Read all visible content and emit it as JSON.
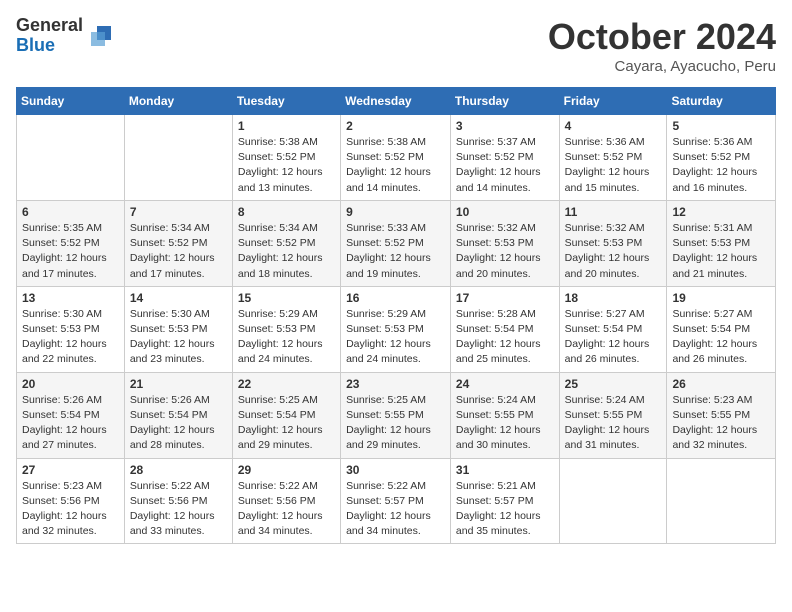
{
  "logo": {
    "general": "General",
    "blue": "Blue"
  },
  "title": "October 2024",
  "subtitle": "Cayara, Ayacucho, Peru",
  "weekdays": [
    "Sunday",
    "Monday",
    "Tuesday",
    "Wednesday",
    "Thursday",
    "Friday",
    "Saturday"
  ],
  "weeks": [
    [
      {
        "day": "",
        "info": ""
      },
      {
        "day": "",
        "info": ""
      },
      {
        "day": "1",
        "info": "Sunrise: 5:38 AM\nSunset: 5:52 PM\nDaylight: 12 hours and 13 minutes."
      },
      {
        "day": "2",
        "info": "Sunrise: 5:38 AM\nSunset: 5:52 PM\nDaylight: 12 hours and 14 minutes."
      },
      {
        "day": "3",
        "info": "Sunrise: 5:37 AM\nSunset: 5:52 PM\nDaylight: 12 hours and 14 minutes."
      },
      {
        "day": "4",
        "info": "Sunrise: 5:36 AM\nSunset: 5:52 PM\nDaylight: 12 hours and 15 minutes."
      },
      {
        "day": "5",
        "info": "Sunrise: 5:36 AM\nSunset: 5:52 PM\nDaylight: 12 hours and 16 minutes."
      }
    ],
    [
      {
        "day": "6",
        "info": "Sunrise: 5:35 AM\nSunset: 5:52 PM\nDaylight: 12 hours and 17 minutes."
      },
      {
        "day": "7",
        "info": "Sunrise: 5:34 AM\nSunset: 5:52 PM\nDaylight: 12 hours and 17 minutes."
      },
      {
        "day": "8",
        "info": "Sunrise: 5:34 AM\nSunset: 5:52 PM\nDaylight: 12 hours and 18 minutes."
      },
      {
        "day": "9",
        "info": "Sunrise: 5:33 AM\nSunset: 5:52 PM\nDaylight: 12 hours and 19 minutes."
      },
      {
        "day": "10",
        "info": "Sunrise: 5:32 AM\nSunset: 5:53 PM\nDaylight: 12 hours and 20 minutes."
      },
      {
        "day": "11",
        "info": "Sunrise: 5:32 AM\nSunset: 5:53 PM\nDaylight: 12 hours and 20 minutes."
      },
      {
        "day": "12",
        "info": "Sunrise: 5:31 AM\nSunset: 5:53 PM\nDaylight: 12 hours and 21 minutes."
      }
    ],
    [
      {
        "day": "13",
        "info": "Sunrise: 5:30 AM\nSunset: 5:53 PM\nDaylight: 12 hours and 22 minutes."
      },
      {
        "day": "14",
        "info": "Sunrise: 5:30 AM\nSunset: 5:53 PM\nDaylight: 12 hours and 23 minutes."
      },
      {
        "day": "15",
        "info": "Sunrise: 5:29 AM\nSunset: 5:53 PM\nDaylight: 12 hours and 24 minutes."
      },
      {
        "day": "16",
        "info": "Sunrise: 5:29 AM\nSunset: 5:53 PM\nDaylight: 12 hours and 24 minutes."
      },
      {
        "day": "17",
        "info": "Sunrise: 5:28 AM\nSunset: 5:54 PM\nDaylight: 12 hours and 25 minutes."
      },
      {
        "day": "18",
        "info": "Sunrise: 5:27 AM\nSunset: 5:54 PM\nDaylight: 12 hours and 26 minutes."
      },
      {
        "day": "19",
        "info": "Sunrise: 5:27 AM\nSunset: 5:54 PM\nDaylight: 12 hours and 26 minutes."
      }
    ],
    [
      {
        "day": "20",
        "info": "Sunrise: 5:26 AM\nSunset: 5:54 PM\nDaylight: 12 hours and 27 minutes."
      },
      {
        "day": "21",
        "info": "Sunrise: 5:26 AM\nSunset: 5:54 PM\nDaylight: 12 hours and 28 minutes."
      },
      {
        "day": "22",
        "info": "Sunrise: 5:25 AM\nSunset: 5:54 PM\nDaylight: 12 hours and 29 minutes."
      },
      {
        "day": "23",
        "info": "Sunrise: 5:25 AM\nSunset: 5:55 PM\nDaylight: 12 hours and 29 minutes."
      },
      {
        "day": "24",
        "info": "Sunrise: 5:24 AM\nSunset: 5:55 PM\nDaylight: 12 hours and 30 minutes."
      },
      {
        "day": "25",
        "info": "Sunrise: 5:24 AM\nSunset: 5:55 PM\nDaylight: 12 hours and 31 minutes."
      },
      {
        "day": "26",
        "info": "Sunrise: 5:23 AM\nSunset: 5:55 PM\nDaylight: 12 hours and 32 minutes."
      }
    ],
    [
      {
        "day": "27",
        "info": "Sunrise: 5:23 AM\nSunset: 5:56 PM\nDaylight: 12 hours and 32 minutes."
      },
      {
        "day": "28",
        "info": "Sunrise: 5:22 AM\nSunset: 5:56 PM\nDaylight: 12 hours and 33 minutes."
      },
      {
        "day": "29",
        "info": "Sunrise: 5:22 AM\nSunset: 5:56 PM\nDaylight: 12 hours and 34 minutes."
      },
      {
        "day": "30",
        "info": "Sunrise: 5:22 AM\nSunset: 5:57 PM\nDaylight: 12 hours and 34 minutes."
      },
      {
        "day": "31",
        "info": "Sunrise: 5:21 AM\nSunset: 5:57 PM\nDaylight: 12 hours and 35 minutes."
      },
      {
        "day": "",
        "info": ""
      },
      {
        "day": "",
        "info": ""
      }
    ]
  ]
}
